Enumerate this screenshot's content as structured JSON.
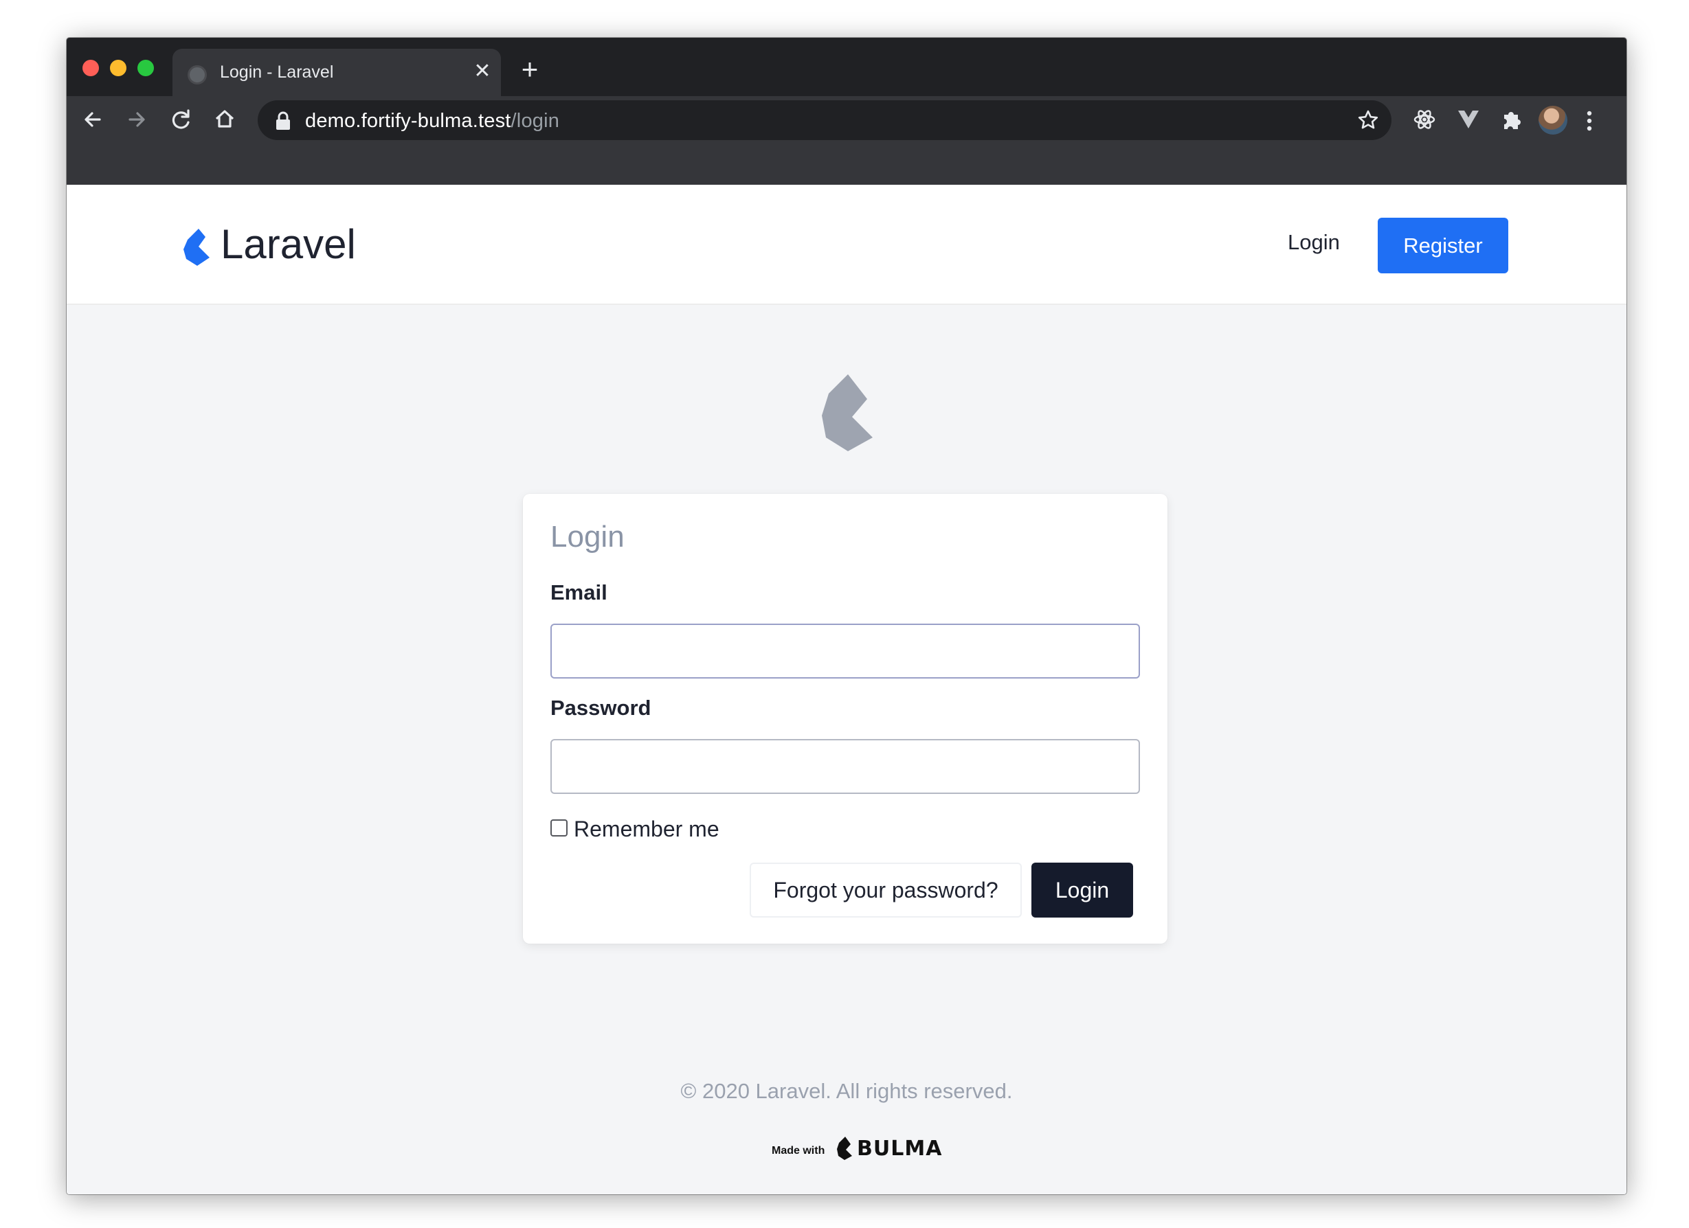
{
  "browser": {
    "tab_title": "Login - Laravel",
    "close_glyph": "✕",
    "new_tab_glyph": "+",
    "url_host": "demo.fortify-bulma.test",
    "url_path": "/login",
    "icons": [
      "back-icon",
      "forward-icon",
      "reload-icon",
      "home-icon",
      "lock-icon",
      "star-icon",
      "react-devtools-icon",
      "vue-devtools-icon",
      "extensions-icon",
      "profile-avatar",
      "menu-icon"
    ]
  },
  "navbar": {
    "brand": "Laravel",
    "login_link": "Login",
    "register_button": "Register",
    "accent_color": "#1f6ff4"
  },
  "login_card": {
    "title": "Login",
    "email_label": "Email",
    "email_value": "",
    "password_label": "Password",
    "password_value": "",
    "remember_label": "Remember me",
    "remember_checked": false,
    "forgot_button": "Forgot your password?",
    "submit_button": "Login"
  },
  "footer": {
    "copyright": "© 2020 Laravel. All rights reserved.",
    "made_with": "Made with",
    "bulma": "BULMA"
  }
}
